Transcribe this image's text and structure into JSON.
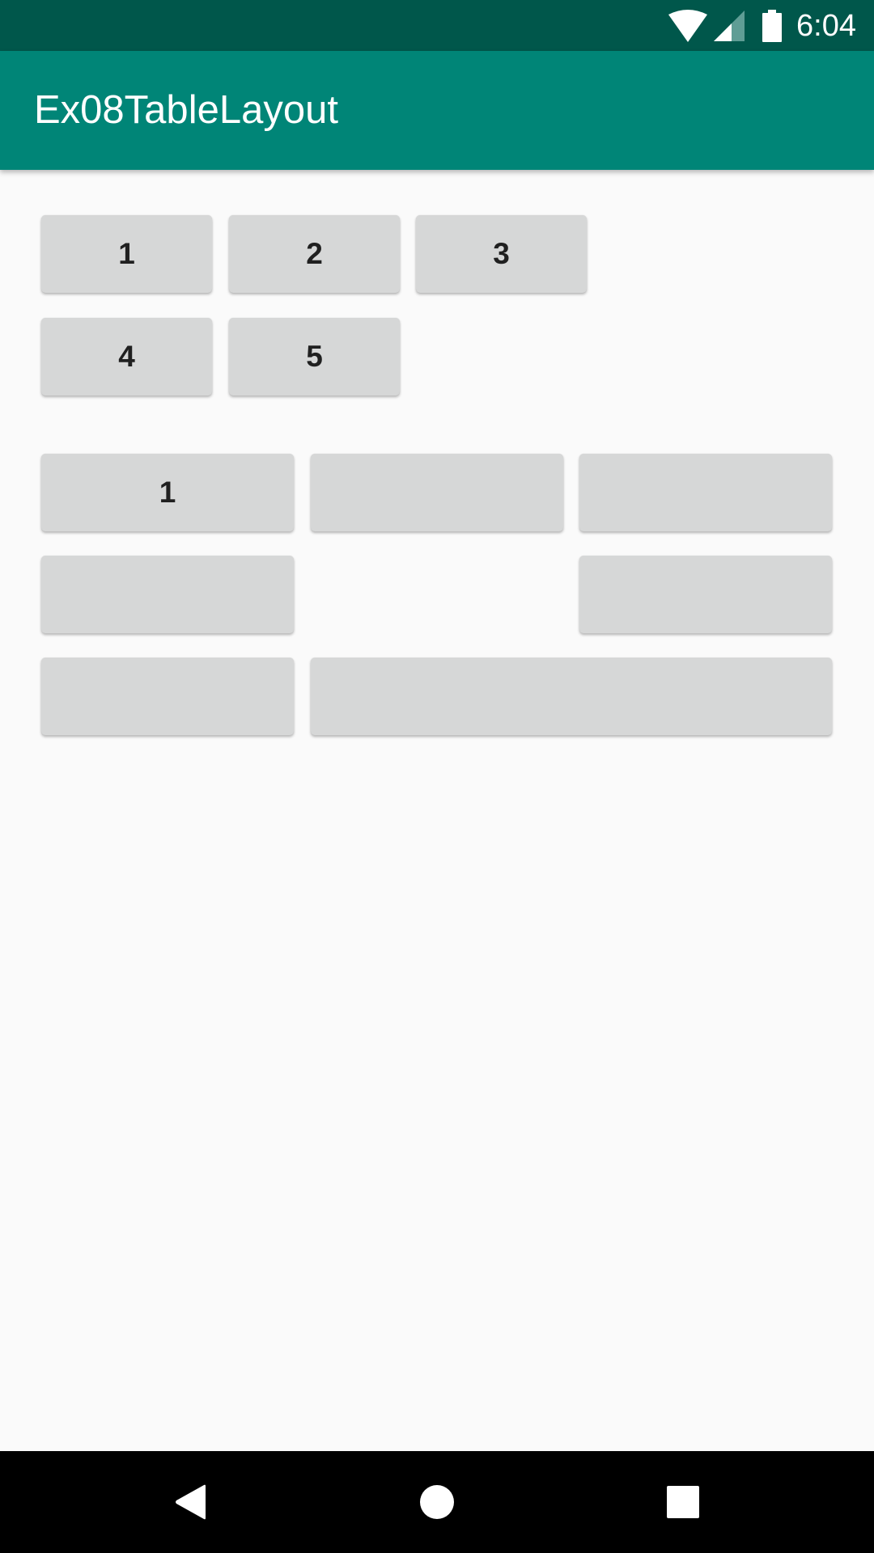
{
  "status_bar": {
    "time": "6:04",
    "icons": [
      "wifi-icon",
      "cell-signal-icon",
      "battery-icon"
    ]
  },
  "app_bar": {
    "title": "Ex08TableLayout"
  },
  "table1": {
    "rows": [
      [
        "1",
        "2",
        "3"
      ],
      [
        "4",
        "5"
      ]
    ]
  },
  "table2": {
    "rows": [
      [
        "1",
        "",
        ""
      ],
      [
        "",
        ""
      ],
      [
        "",
        ""
      ]
    ]
  },
  "nav_bar": {
    "icons": [
      "back-icon",
      "home-icon",
      "recents-icon"
    ]
  },
  "colors": {
    "status_bar": "#00574b",
    "app_bar": "#008577",
    "background": "#fafafa",
    "button": "#d6d7d7"
  }
}
